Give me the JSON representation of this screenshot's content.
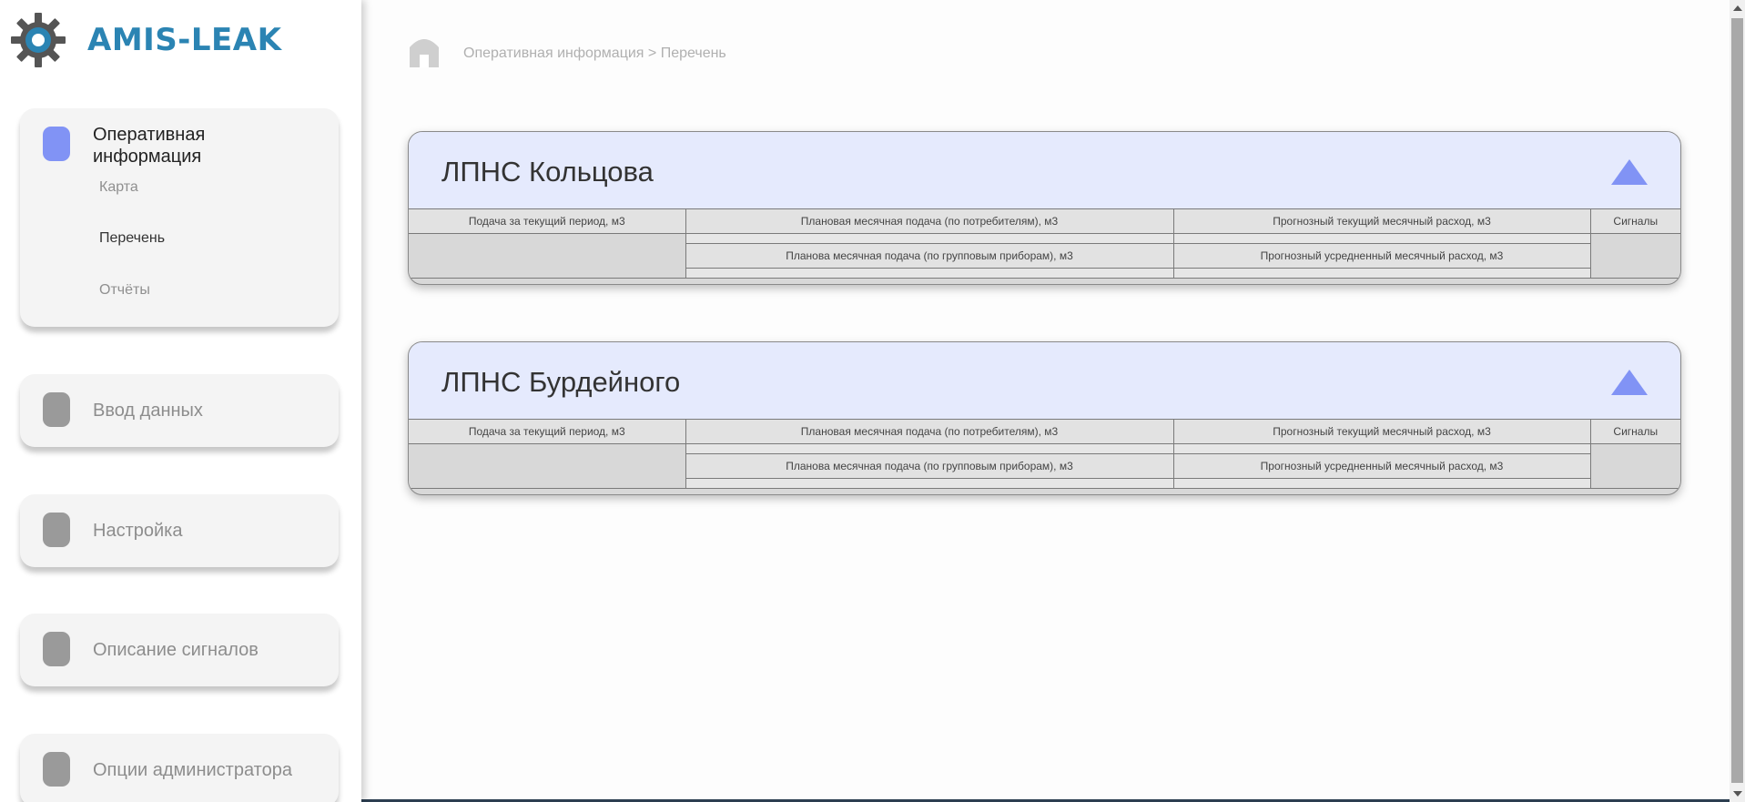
{
  "app": {
    "logo_text": "AMIS-LEAK"
  },
  "sidebar": {
    "active_section": {
      "title": "Оперативная информация",
      "items": [
        {
          "label": "Карта"
        },
        {
          "label": "Перечень"
        },
        {
          "label": "Отчёты"
        }
      ]
    },
    "sections": [
      {
        "label": "Ввод данных"
      },
      {
        "label": "Настройка"
      },
      {
        "label": "Описание сигналов"
      },
      {
        "label": "Опции администратора"
      }
    ]
  },
  "breadcrumb": {
    "text": "Оперативная информация > Перечень"
  },
  "columns": {
    "supply_current": "Подача за текущий период, м3",
    "planned_consumers": "Плановая месячная подача (по потребителям), м3",
    "forecast_current": "Прогнозный текущий месячный расход, м3",
    "signals": "Сигналы",
    "planned_group": "Планова месячная подача (по групповым приборам), м3",
    "forecast_avg": "Прогнозный усредненный месячный расход, м3"
  },
  "stations": [
    {
      "name": "ЛПНС Кольцова"
    },
    {
      "name": "ЛПНС Бурдейного"
    }
  ],
  "colors": {
    "brand": "#2b84b3",
    "accent": "#8193f5",
    "card_header": "#e5eafd"
  }
}
